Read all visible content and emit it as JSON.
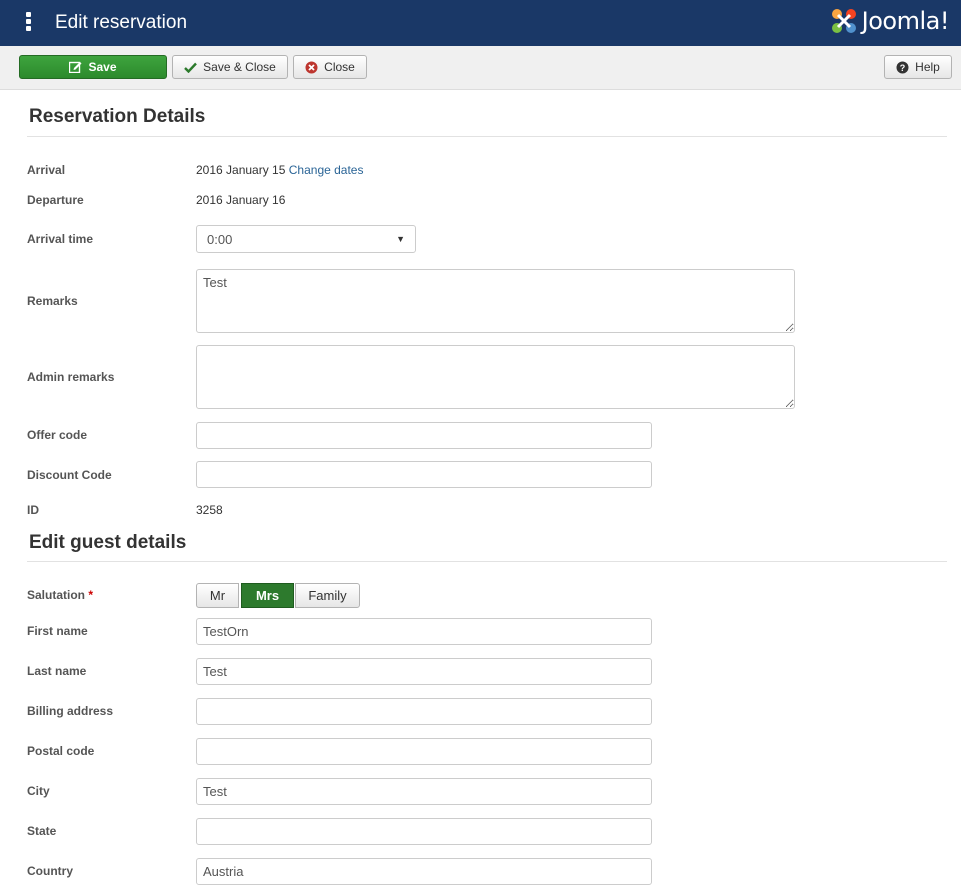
{
  "header": {
    "title": "Edit reservation",
    "brand": "Joomla!",
    "brand_color": "#1a3867"
  },
  "toolbar": {
    "save_label": "Save",
    "save_close_label": "Save & Close",
    "close_label": "Close",
    "help_label": "Help"
  },
  "reservation": {
    "section_title": "Reservation Details",
    "arrival_label": "Arrival",
    "arrival_value": "2016 January 15",
    "change_dates_link": "Change dates",
    "departure_label": "Departure",
    "departure_value": "2016 January 16",
    "arrival_time_label": "Arrival time",
    "arrival_time_value": "0:00",
    "remarks_label": "Remarks",
    "remarks_value": "Test",
    "admin_remarks_label": "Admin remarks",
    "admin_remarks_value": "",
    "offer_code_label": "Offer code",
    "offer_code_value": "",
    "discount_code_label": "Discount Code",
    "discount_code_value": "",
    "id_label": "ID",
    "id_value": "3258"
  },
  "guest": {
    "section_title": "Edit guest details",
    "salutation_label": "Salutation",
    "required_marker": "*",
    "salutation_options": [
      "Mr",
      "Mrs",
      "Family"
    ],
    "salutation_selected": "Mrs",
    "first_name_label": "First name",
    "first_name_value": "TestOrn",
    "last_name_label": "Last name",
    "last_name_value": "Test",
    "billing_address_label": "Billing address",
    "billing_address_value": "",
    "postal_code_label": "Postal code",
    "postal_code_value": "",
    "city_label": "City",
    "city_value": "Test",
    "state_label": "State",
    "state_value": "",
    "country_label": "Country",
    "country_value": "Austria"
  }
}
